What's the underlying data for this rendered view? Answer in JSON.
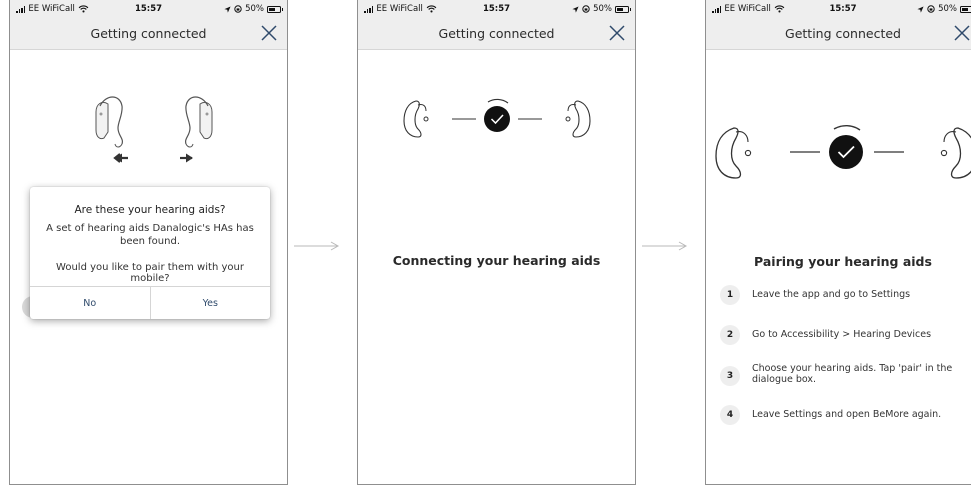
{
  "status_bar": {
    "carrier": "EE WiFiCall",
    "time": "15:57",
    "battery": "50%"
  },
  "nav": {
    "title": "Getting connected"
  },
  "screen1": {
    "dialog": {
      "title": "Are these your hearing aids?",
      "message": "A set of hearing aids Danalogic's HAs has been found.",
      "question": "Would you like to pair them with your mobile?",
      "no_label": "No",
      "yes_label": "Yes"
    }
  },
  "screen2": {
    "status_text": "Connecting your hearing aids"
  },
  "screen3": {
    "title": "Pairing your hearing aids",
    "steps": [
      {
        "number": "1",
        "text": "Leave the app and go to Settings"
      },
      {
        "number": "2",
        "text": "Go to Accessibility > Hearing Devices"
      },
      {
        "number": "3",
        "text": "Choose your hearing aids. Tap 'pair' in the dialogue box."
      },
      {
        "number": "4",
        "text": "Leave Settings and open BeMore again."
      }
    ]
  },
  "icons": {
    "close": "close-icon",
    "arrow": "arrow-right-icon",
    "check": "check-icon",
    "hearing_aid": "hearing-aid-icon",
    "wifi": "wifi-icon",
    "battery": "battery-icon",
    "location": "location-icon"
  },
  "colors": {
    "header_bg": "#eeeeee",
    "dialog_button_text": "#2f4a6b",
    "check_circle": "#111111",
    "connector_arrow": "#b8b8b8"
  }
}
